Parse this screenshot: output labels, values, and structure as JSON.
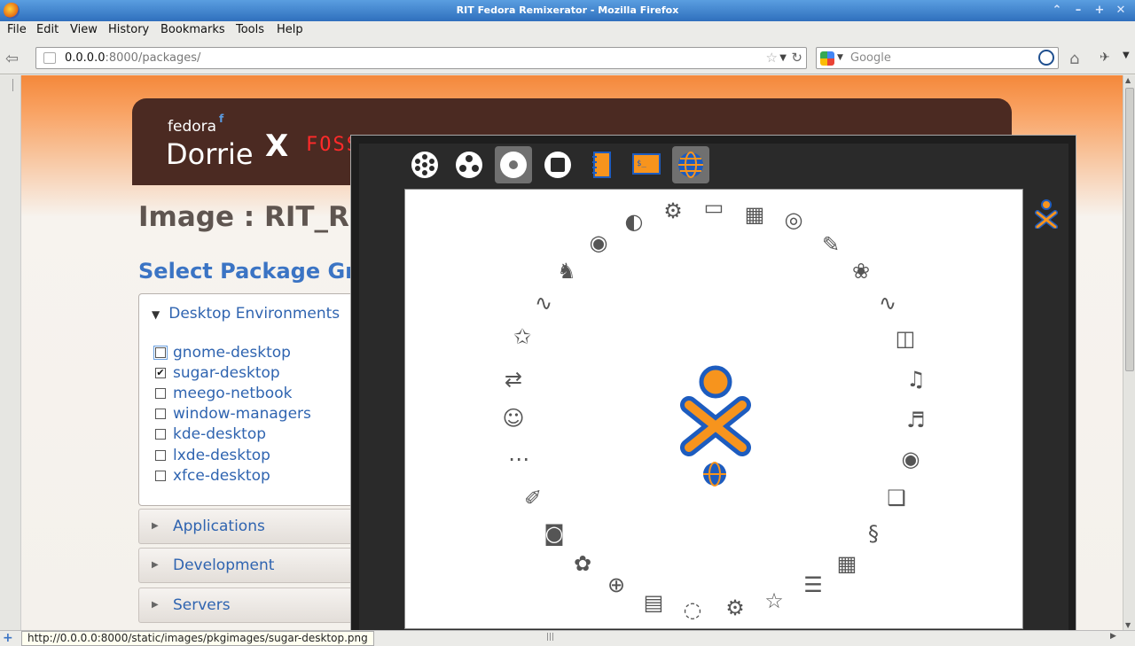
{
  "window": {
    "title": "RIT Fedora Remixerator - Mozilla Firefox",
    "min": "–",
    "max": "+",
    "close": "✕",
    "roll": "⌃"
  },
  "menu": {
    "file": "File",
    "edit": "Edit",
    "view": "View",
    "history": "History",
    "bookmarks": "Bookmarks",
    "tools": "Tools",
    "help": "Help"
  },
  "nav": {
    "url_host": "0.0.0.0",
    "url_path": ":8000/packages/",
    "search_placeholder": "Google"
  },
  "banner": {
    "fedora": "fedora",
    "f_glyph": "f",
    "dorrie": "Dorrie",
    "x": "X",
    "foss": "FOSS"
  },
  "page": {
    "image_title": "Image : RIT_R",
    "select_title": "Select Package Gr"
  },
  "group": {
    "label": "Desktop Environments",
    "packages": [
      {
        "name": "gnome-desktop",
        "checked": ""
      },
      {
        "name": "sugar-desktop",
        "checked": "✔"
      },
      {
        "name": "meego-netbook",
        "checked": ""
      },
      {
        "name": "window-managers",
        "checked": ""
      },
      {
        "name": "kde-desktop",
        "checked": ""
      },
      {
        "name": "lxde-desktop",
        "checked": ""
      },
      {
        "name": "xfce-desktop",
        "checked": ""
      }
    ]
  },
  "accordions": [
    "Applications",
    "Development",
    "Servers"
  ],
  "status": {
    "url": "http://0.0.0.0:8000/static/images/pkgimages/sugar-desktop.png"
  },
  "colors": {
    "accent": "#3b74c4",
    "banner": "#4b2a22",
    "xo_orange": "#f7941d",
    "xo_blue": "#1d5cbf"
  },
  "sugar_toolbar": [
    "neighborhood-icon",
    "group-icon",
    "home-icon",
    "activity-icon",
    "journal-icon",
    "terminal-icon",
    "browse-icon"
  ]
}
